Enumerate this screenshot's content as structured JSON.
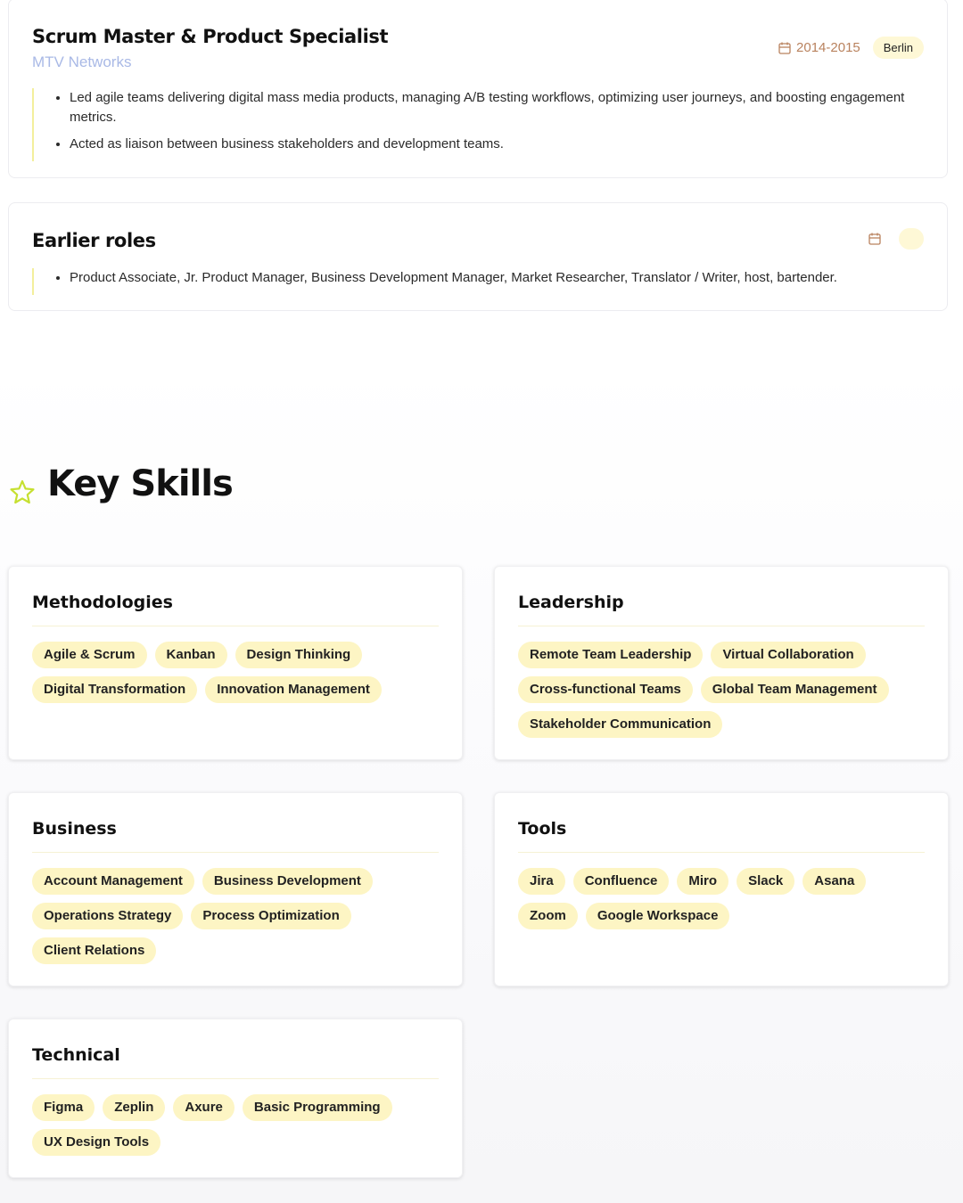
{
  "experience": [
    {
      "title": "Scrum Master & Product Specialist",
      "company": "MTV Networks",
      "dates": "2014-2015",
      "location": "Berlin",
      "bullets": [
        "Led agile teams delivering digital mass media products, managing A/B testing workflows, optimizing user journeys, and boosting engagement metrics.",
        "Acted as liaison between business stakeholders and development teams."
      ]
    },
    {
      "title": "Earlier roles",
      "company": "",
      "dates": "",
      "location": "",
      "bullets": [
        "Product Associate, Jr. Product Manager, Business Development Manager, Market Researcher, Translator / Writer, host, bartender."
      ]
    }
  ],
  "key_skills": {
    "title": "Key Skills",
    "icon": "star-icon",
    "groups": [
      {
        "name": "Methodologies",
        "items": [
          "Agile & Scrum",
          "Kanban",
          "Design Thinking",
          "Digital Transformation",
          "Innovation Management"
        ]
      },
      {
        "name": "Leadership",
        "items": [
          "Remote Team Leadership",
          "Virtual Collaboration",
          "Cross-functional Teams",
          "Global Team Management",
          "Stakeholder Communication"
        ]
      },
      {
        "name": "Business",
        "items": [
          "Account Management",
          "Business Development",
          "Operations Strategy",
          "Process Optimization",
          "Client Relations"
        ]
      },
      {
        "name": "Tools",
        "items": [
          "Jira",
          "Confluence",
          "Miro",
          "Slack",
          "Asana",
          "Zoom",
          "Google Workspace"
        ]
      },
      {
        "name": "Technical",
        "items": [
          "Figma",
          "Zeplin",
          "Axure",
          "Basic Programming",
          "UX Design Tools"
        ]
      }
    ]
  },
  "colors": {
    "accent_yellow": "#fdf5c4",
    "company_blue": "#a9b9e6",
    "date_brown": "#b9825e",
    "star_green": "#c6e030"
  }
}
